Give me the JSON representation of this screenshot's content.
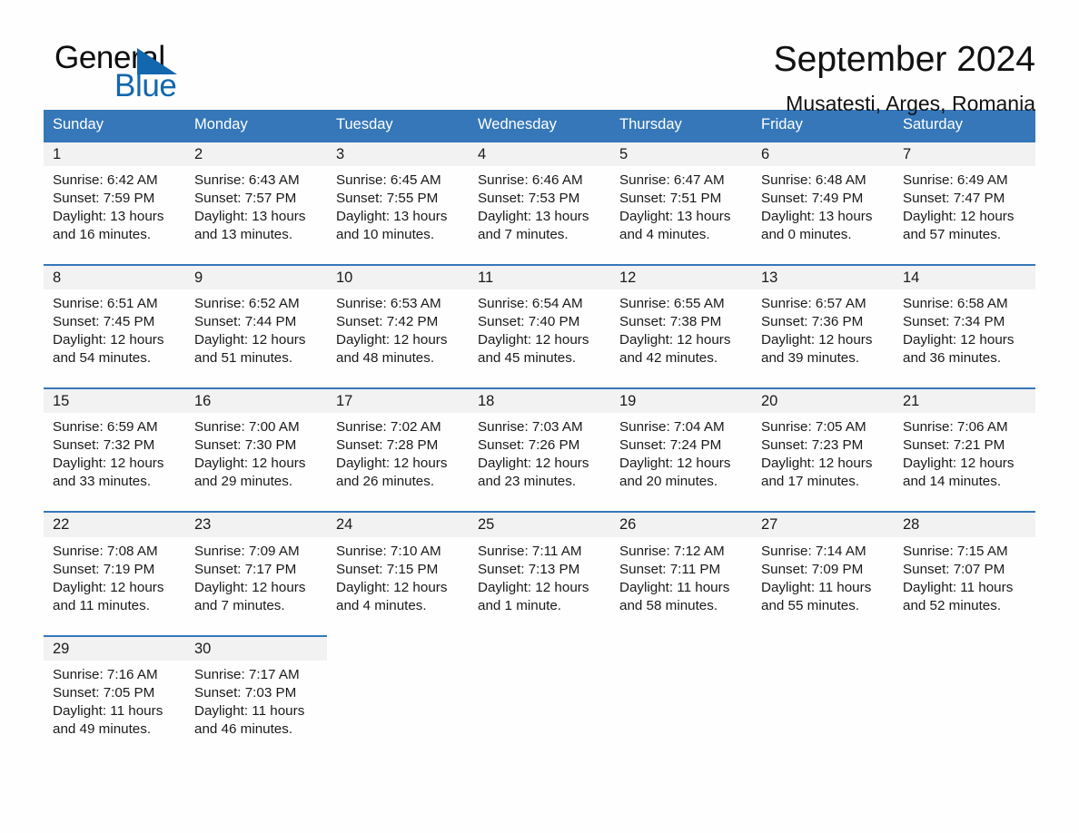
{
  "logo": {
    "word1": "General",
    "word2": "Blue",
    "triangle_color": "#1267ae"
  },
  "header": {
    "title": "September 2024",
    "subtitle": "Musatesti, Arges, Romania"
  },
  "theme": {
    "header_blue": "#3577b9",
    "daynum_bg": "#f2f2f2",
    "page_bg": "#fefefe"
  },
  "calendar": {
    "weekday_headers": [
      "Sunday",
      "Monday",
      "Tuesday",
      "Wednesday",
      "Thursday",
      "Friday",
      "Saturday"
    ],
    "labels": {
      "sunrise": "Sunrise:",
      "sunset": "Sunset:",
      "daylight": "Daylight:"
    },
    "weeks": [
      [
        {
          "day": "1",
          "sunrise": "Sunrise: 6:42 AM",
          "sunset": "Sunset: 7:59 PM",
          "daylight_line1": "Daylight: 13 hours",
          "daylight_line2": "and 16 minutes."
        },
        {
          "day": "2",
          "sunrise": "Sunrise: 6:43 AM",
          "sunset": "Sunset: 7:57 PM",
          "daylight_line1": "Daylight: 13 hours",
          "daylight_line2": "and 13 minutes."
        },
        {
          "day": "3",
          "sunrise": "Sunrise: 6:45 AM",
          "sunset": "Sunset: 7:55 PM",
          "daylight_line1": "Daylight: 13 hours",
          "daylight_line2": "and 10 minutes."
        },
        {
          "day": "4",
          "sunrise": "Sunrise: 6:46 AM",
          "sunset": "Sunset: 7:53 PM",
          "daylight_line1": "Daylight: 13 hours",
          "daylight_line2": "and 7 minutes."
        },
        {
          "day": "5",
          "sunrise": "Sunrise: 6:47 AM",
          "sunset": "Sunset: 7:51 PM",
          "daylight_line1": "Daylight: 13 hours",
          "daylight_line2": "and 4 minutes."
        },
        {
          "day": "6",
          "sunrise": "Sunrise: 6:48 AM",
          "sunset": "Sunset: 7:49 PM",
          "daylight_line1": "Daylight: 13 hours",
          "daylight_line2": "and 0 minutes."
        },
        {
          "day": "7",
          "sunrise": "Sunrise: 6:49 AM",
          "sunset": "Sunset: 7:47 PM",
          "daylight_line1": "Daylight: 12 hours",
          "daylight_line2": "and 57 minutes."
        }
      ],
      [
        {
          "day": "8",
          "sunrise": "Sunrise: 6:51 AM",
          "sunset": "Sunset: 7:45 PM",
          "daylight_line1": "Daylight: 12 hours",
          "daylight_line2": "and 54 minutes."
        },
        {
          "day": "9",
          "sunrise": "Sunrise: 6:52 AM",
          "sunset": "Sunset: 7:44 PM",
          "daylight_line1": "Daylight: 12 hours",
          "daylight_line2": "and 51 minutes."
        },
        {
          "day": "10",
          "sunrise": "Sunrise: 6:53 AM",
          "sunset": "Sunset: 7:42 PM",
          "daylight_line1": "Daylight: 12 hours",
          "daylight_line2": "and 48 minutes."
        },
        {
          "day": "11",
          "sunrise": "Sunrise: 6:54 AM",
          "sunset": "Sunset: 7:40 PM",
          "daylight_line1": "Daylight: 12 hours",
          "daylight_line2": "and 45 minutes."
        },
        {
          "day": "12",
          "sunrise": "Sunrise: 6:55 AM",
          "sunset": "Sunset: 7:38 PM",
          "daylight_line1": "Daylight: 12 hours",
          "daylight_line2": "and 42 minutes."
        },
        {
          "day": "13",
          "sunrise": "Sunrise: 6:57 AM",
          "sunset": "Sunset: 7:36 PM",
          "daylight_line1": "Daylight: 12 hours",
          "daylight_line2": "and 39 minutes."
        },
        {
          "day": "14",
          "sunrise": "Sunrise: 6:58 AM",
          "sunset": "Sunset: 7:34 PM",
          "daylight_line1": "Daylight: 12 hours",
          "daylight_line2": "and 36 minutes."
        }
      ],
      [
        {
          "day": "15",
          "sunrise": "Sunrise: 6:59 AM",
          "sunset": "Sunset: 7:32 PM",
          "daylight_line1": "Daylight: 12 hours",
          "daylight_line2": "and 33 minutes."
        },
        {
          "day": "16",
          "sunrise": "Sunrise: 7:00 AM",
          "sunset": "Sunset: 7:30 PM",
          "daylight_line1": "Daylight: 12 hours",
          "daylight_line2": "and 29 minutes."
        },
        {
          "day": "17",
          "sunrise": "Sunrise: 7:02 AM",
          "sunset": "Sunset: 7:28 PM",
          "daylight_line1": "Daylight: 12 hours",
          "daylight_line2": "and 26 minutes."
        },
        {
          "day": "18",
          "sunrise": "Sunrise: 7:03 AM",
          "sunset": "Sunset: 7:26 PM",
          "daylight_line1": "Daylight: 12 hours",
          "daylight_line2": "and 23 minutes."
        },
        {
          "day": "19",
          "sunrise": "Sunrise: 7:04 AM",
          "sunset": "Sunset: 7:24 PM",
          "daylight_line1": "Daylight: 12 hours",
          "daylight_line2": "and 20 minutes."
        },
        {
          "day": "20",
          "sunrise": "Sunrise: 7:05 AM",
          "sunset": "Sunset: 7:23 PM",
          "daylight_line1": "Daylight: 12 hours",
          "daylight_line2": "and 17 minutes."
        },
        {
          "day": "21",
          "sunrise": "Sunrise: 7:06 AM",
          "sunset": "Sunset: 7:21 PM",
          "daylight_line1": "Daylight: 12 hours",
          "daylight_line2": "and 14 minutes."
        }
      ],
      [
        {
          "day": "22",
          "sunrise": "Sunrise: 7:08 AM",
          "sunset": "Sunset: 7:19 PM",
          "daylight_line1": "Daylight: 12 hours",
          "daylight_line2": "and 11 minutes."
        },
        {
          "day": "23",
          "sunrise": "Sunrise: 7:09 AM",
          "sunset": "Sunset: 7:17 PM",
          "daylight_line1": "Daylight: 12 hours",
          "daylight_line2": "and 7 minutes."
        },
        {
          "day": "24",
          "sunrise": "Sunrise: 7:10 AM",
          "sunset": "Sunset: 7:15 PM",
          "daylight_line1": "Daylight: 12 hours",
          "daylight_line2": "and 4 minutes."
        },
        {
          "day": "25",
          "sunrise": "Sunrise: 7:11 AM",
          "sunset": "Sunset: 7:13 PM",
          "daylight_line1": "Daylight: 12 hours",
          "daylight_line2": "and 1 minute."
        },
        {
          "day": "26",
          "sunrise": "Sunrise: 7:12 AM",
          "sunset": "Sunset: 7:11 PM",
          "daylight_line1": "Daylight: 11 hours",
          "daylight_line2": "and 58 minutes."
        },
        {
          "day": "27",
          "sunrise": "Sunrise: 7:14 AM",
          "sunset": "Sunset: 7:09 PM",
          "daylight_line1": "Daylight: 11 hours",
          "daylight_line2": "and 55 minutes."
        },
        {
          "day": "28",
          "sunrise": "Sunrise: 7:15 AM",
          "sunset": "Sunset: 7:07 PM",
          "daylight_line1": "Daylight: 11 hours",
          "daylight_line2": "and 52 minutes."
        }
      ],
      [
        {
          "day": "29",
          "sunrise": "Sunrise: 7:16 AM",
          "sunset": "Sunset: 7:05 PM",
          "daylight_line1": "Daylight: 11 hours",
          "daylight_line2": "and 49 minutes."
        },
        {
          "day": "30",
          "sunrise": "Sunrise: 7:17 AM",
          "sunset": "Sunset: 7:03 PM",
          "daylight_line1": "Daylight: 11 hours",
          "daylight_line2": "and 46 minutes."
        },
        {
          "day": "",
          "sunrise": "",
          "sunset": "",
          "daylight_line1": "",
          "daylight_line2": ""
        },
        {
          "day": "",
          "sunrise": "",
          "sunset": "",
          "daylight_line1": "",
          "daylight_line2": ""
        },
        {
          "day": "",
          "sunrise": "",
          "sunset": "",
          "daylight_line1": "",
          "daylight_line2": ""
        },
        {
          "day": "",
          "sunrise": "",
          "sunset": "",
          "daylight_line1": "",
          "daylight_line2": ""
        },
        {
          "day": "",
          "sunrise": "",
          "sunset": "",
          "daylight_line1": "",
          "daylight_line2": ""
        }
      ]
    ]
  }
}
